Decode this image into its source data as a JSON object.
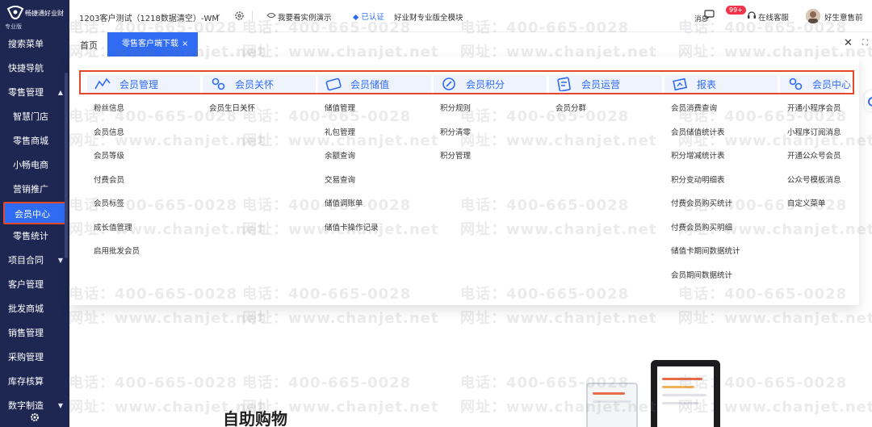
{
  "app": {
    "brand": "畅捷通好业财",
    "edition_badge": "专业版"
  },
  "sidebar": {
    "items": [
      {
        "label": "搜索菜单",
        "level": 1
      },
      {
        "label": "快捷导航",
        "level": 1
      },
      {
        "label": "零售管理",
        "level": 1,
        "expanded": true
      },
      {
        "label": "智慧门店",
        "level": 2
      },
      {
        "label": "零售商城",
        "level": 2
      },
      {
        "label": "小畅电商",
        "level": 2
      },
      {
        "label": "营销推广",
        "level": 2
      },
      {
        "label": "会员中心",
        "level": 2,
        "active": true
      },
      {
        "label": "零售统计",
        "level": 2
      },
      {
        "label": "项目合同",
        "level": 1,
        "collapsed": true
      },
      {
        "label": "客户管理",
        "level": 1
      },
      {
        "label": "批发商城",
        "level": 1
      },
      {
        "label": "销售管理",
        "level": 1
      },
      {
        "label": "采购管理",
        "level": 1
      },
      {
        "label": "库存核算",
        "level": 1
      },
      {
        "label": "数字制造",
        "level": 1,
        "collapsed": true
      }
    ],
    "settings_icon": "gear-icon"
  },
  "topbar": {
    "company": "1203客户测试（1218数据清空）-WM",
    "demo_label": "我要看实例演示",
    "verified_label": "已认证",
    "edition_label": "好业财专业版全模块",
    "messages_label": "消息",
    "messages_badge": "99+",
    "service_label": "在线客服",
    "user_label": "好生意售前"
  },
  "tabs": {
    "home": "首页",
    "active": "零售客户端下载",
    "close_glyph": "×"
  },
  "mega_menu": {
    "categories": [
      {
        "label": "会员管理",
        "icon": "chart-line-icon"
      },
      {
        "label": "会员关怀",
        "icon": "people-care-icon"
      },
      {
        "label": "会员储值",
        "icon": "wallet-icon"
      },
      {
        "label": "会员积分",
        "icon": "points-icon"
      },
      {
        "label": "会员运营",
        "icon": "document-icon"
      },
      {
        "label": "报表",
        "icon": "report-icon"
      },
      {
        "label": "会员中心",
        "icon": "member-center-icon"
      }
    ],
    "columns": [
      [
        "粉丝信息",
        "会员信息",
        "会员等级",
        "付费会员",
        "会员标签",
        "成长值管理",
        "启用批发会员"
      ],
      [
        "会员生日关怀"
      ],
      [
        "储值管理",
        "礼包管理",
        "余额查询",
        "交易查询",
        "储值调账单",
        "储值卡操作记录"
      ],
      [
        "积分规则",
        "积分清零",
        "积分管理"
      ],
      [
        "会员分群"
      ],
      [
        "会员消费查询",
        "会员储值统计表",
        "积分增减统计表",
        "积分变动明细表",
        "付费会员购买统计",
        "付费会员购买明细",
        "储值卡期间数据统计",
        "会员期间数据统计"
      ],
      [
        "开通小程序会员",
        "小程序订阅消息",
        "开通公众号会员",
        "公众号模板消息",
        "自定义菜单"
      ]
    ]
  },
  "content": {
    "promo_title": "自助购物"
  },
  "watermark": {
    "phone": "电话：400-665-0028",
    "site": "网址：www.chanjet.net"
  },
  "colors": {
    "sidebar_bg": "#1e2752",
    "accent": "#2f6bf3",
    "highlight_border": "#e4472f",
    "badge": "#f2344b"
  }
}
